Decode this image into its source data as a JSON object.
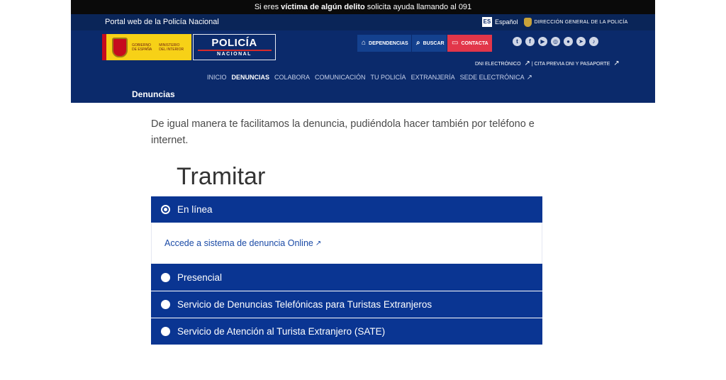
{
  "topbar": {
    "pre": "Si eres",
    "bold1": "víctima de algún delito",
    "post": "solicita ayuda llamando al",
    "number": "091"
  },
  "header": {
    "portal": "Portal web de la Policía Nacional",
    "lang_code": "ES",
    "lang_label": "Español",
    "direccion": "DIRECCIÓN GENERAL DE LA POLICÍA",
    "gov_logo_text_1": "GOBIERNO\nDE ESPAÑA",
    "gov_logo_text_2": "MINISTERIO\nDEL INTERIOR",
    "pn_line1": "POLICÍA",
    "pn_line2": "NACIONAL",
    "buttons": {
      "dependencias": "DEPENDENCIAS",
      "buscar": "BUSCAR",
      "contacta": "CONTACTA"
    },
    "social_icons": [
      "twitter-icon",
      "facebook-icon",
      "youtube-icon",
      "instagram-icon",
      "periscope-icon",
      "telegram-icon",
      "tiktok-icon"
    ],
    "secondary_links": {
      "dni": "DNI ELECTRÓNICO",
      "sep": "|",
      "cita": "CITA PREVIA DNI Y PASAPORTE"
    },
    "nav": [
      "INICIO",
      "DENUNCIAS",
      "COLABORA",
      "COMUNICACIÓN",
      "TU POLICÍA",
      "EXTRANJERÍA",
      "SEDE ELECTRÓNICA"
    ],
    "nav_active": "DENUNCIAS",
    "breadcrumb": "Denuncias"
  },
  "content": {
    "intro": "De igual manera te facilitamos la denuncia, pudiéndola hacer también por teléfono e internet.",
    "heading": "Tramitar",
    "accordion": {
      "open_label": "En línea",
      "open_link": "Accede a sistema de denuncia Online",
      "presencial": "Presencial",
      "telefonicas": "Servicio de Denuncias Telefónicas para Turistas Extranjeros",
      "sate": "Servicio de Atención al Turista Extranjero (SATE)"
    }
  },
  "colors": {
    "header_bg": "#0b2a6b",
    "accordion_bg": "#0a3592",
    "contacta_bg": "#e2364a",
    "link": "#1a4aa6"
  }
}
